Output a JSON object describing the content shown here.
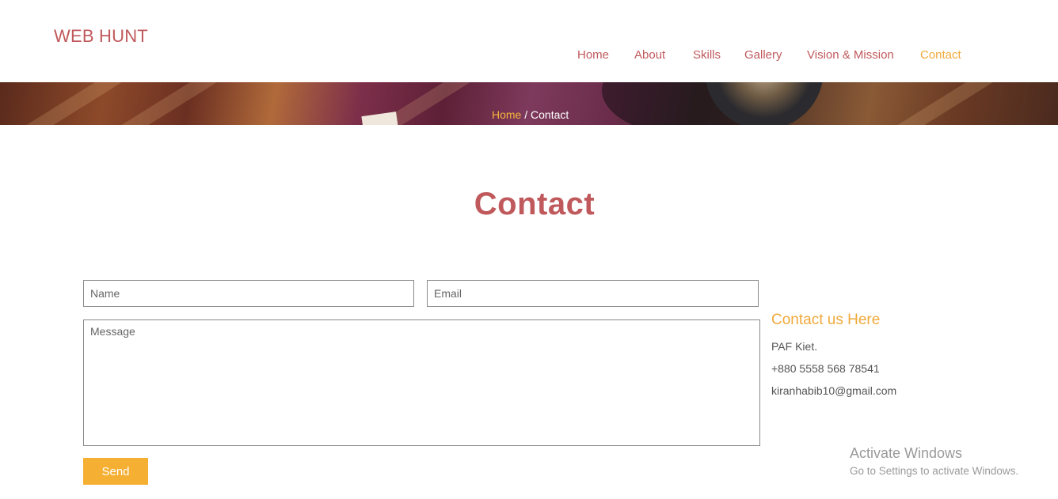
{
  "header": {
    "logo": "WEB HUNT",
    "nav": [
      {
        "label": "Home",
        "active": false
      },
      {
        "label": "About",
        "active": false
      },
      {
        "label": "Skills",
        "active": false
      },
      {
        "label": "Gallery",
        "active": false
      },
      {
        "label": "Vision & Mission",
        "active": false
      },
      {
        "label": "Contact",
        "active": true
      }
    ]
  },
  "breadcrumb": {
    "home": "Home",
    "separator": " / ",
    "current": "Contact"
  },
  "page": {
    "title": "Contact"
  },
  "form": {
    "name_placeholder": "Name",
    "email_placeholder": "Email",
    "message_placeholder": "Message",
    "send_label": "Send"
  },
  "contact_info": {
    "heading": "Contact us Here",
    "address": "PAF Kiet.",
    "phone": "+880 5558 568 78541",
    "email": "kiranhabib10@gmail.com"
  },
  "watermark": {
    "title": "Activate Windows",
    "subtitle": "Go to Settings to activate Windows."
  },
  "colors": {
    "brand": "#c0595c",
    "accent": "#f0a93b",
    "button": "#f5af33"
  }
}
